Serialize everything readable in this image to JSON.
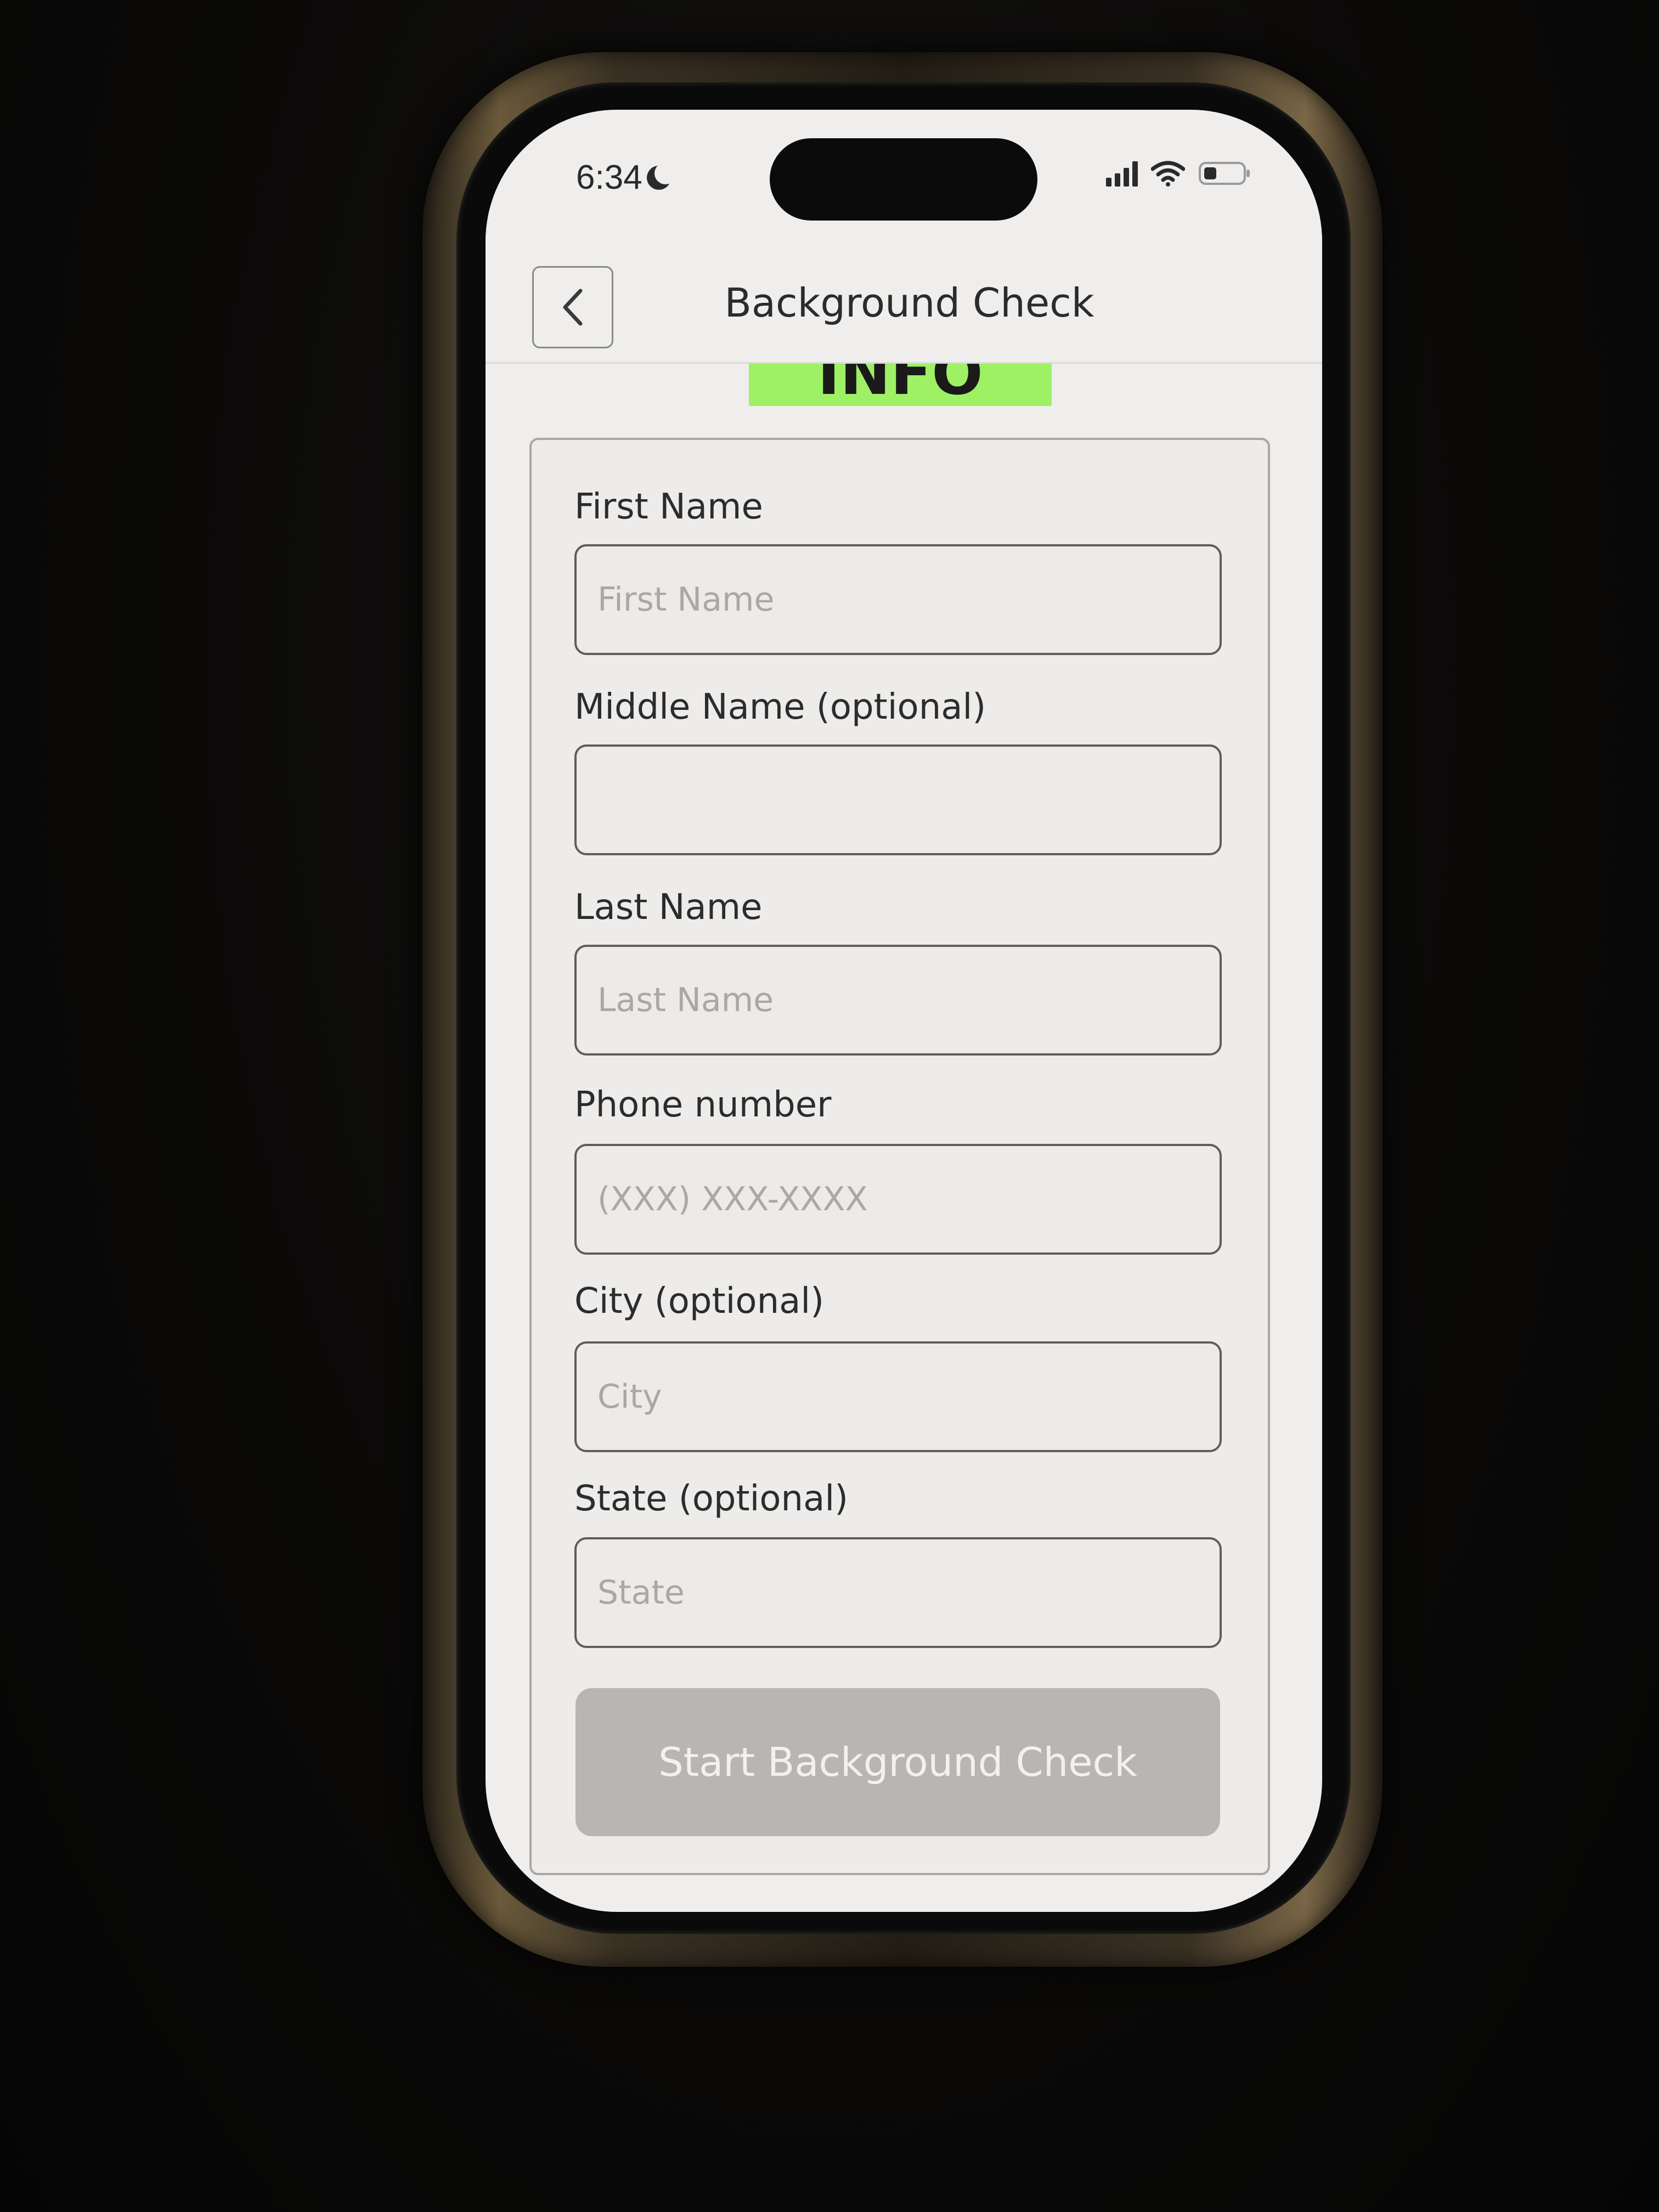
{
  "status_bar": {
    "time": "6:34",
    "icons": [
      "moon-icon",
      "signal-icon",
      "wifi-icon",
      "battery-icon"
    ]
  },
  "header": {
    "title": "Background Check",
    "back_icon": "chevron-left-icon"
  },
  "section": {
    "title": "HIS INFO",
    "highlight_color": "#9ef065"
  },
  "form": {
    "fields": [
      {
        "label": "First Name",
        "placeholder": "First Name",
        "value": ""
      },
      {
        "label": "Middle Name (optional)",
        "placeholder": "",
        "value": ""
      },
      {
        "label": "Last Name",
        "placeholder": "Last Name",
        "value": ""
      },
      {
        "label": "Phone number",
        "placeholder": "(XXX) XXX-XXXX",
        "value": ""
      },
      {
        "label": "City (optional)",
        "placeholder": "City",
        "value": ""
      },
      {
        "label": "State (optional)",
        "placeholder": "State",
        "value": ""
      }
    ],
    "submit_label": "Start Background Check"
  }
}
